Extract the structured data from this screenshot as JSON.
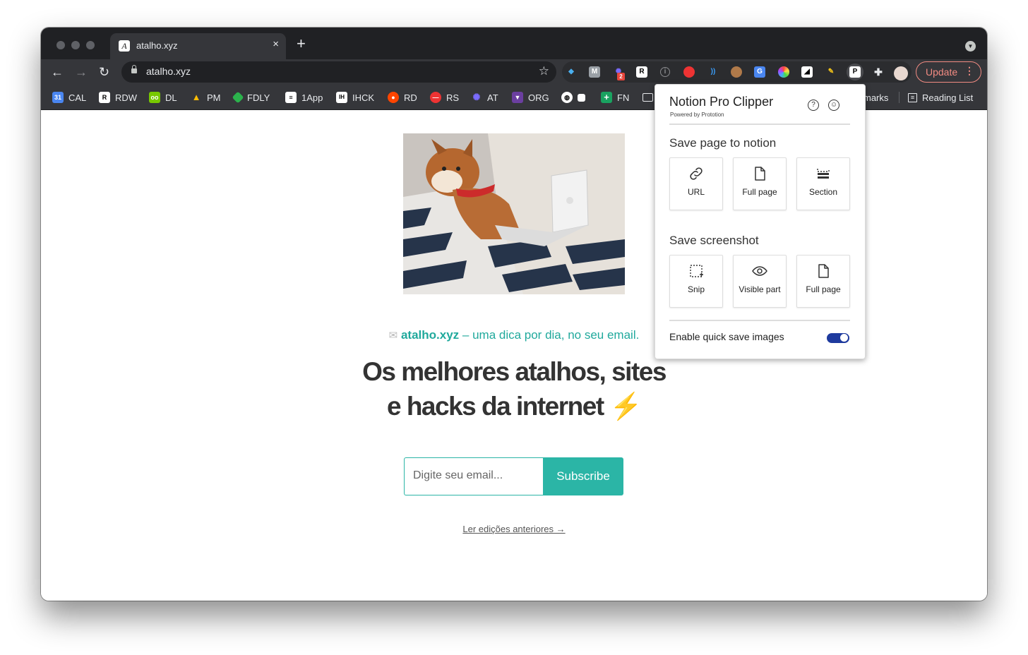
{
  "browser": {
    "tab_title": "atalho.xyz",
    "tab_close": "×",
    "new_tab": "+",
    "url": "atalho.xyz",
    "update_label": "Update",
    "bookmarks": [
      "CAL",
      "RDW",
      "DL",
      "PM",
      "FDLY",
      "1App",
      "IHCK",
      "RD",
      "RS",
      "AT",
      "ORG",
      "FN"
    ],
    "bookmarks_more": "marks",
    "reading_list": "Reading List",
    "extension_badge": "2"
  },
  "page": {
    "tagline_site": "atalho.xyz",
    "tagline_rest": " – uma dica por dia, no seu email.",
    "headline_line1": "Os melhores atalhos, sites",
    "headline_line2": "e hacks da internet",
    "headline_emoji": "⚡",
    "email_placeholder": "Digite seu email...",
    "subscribe_label": "Subscribe",
    "previous_link": "Ler edições anteriores →"
  },
  "popup": {
    "title": "Notion Pro Clipper",
    "subtitle": "Powered by Prototion",
    "section1": "Save page to notion",
    "section1_buttons": [
      "URL",
      "Full page",
      "Section"
    ],
    "section2": "Save screenshot",
    "section2_buttons": [
      "Snip",
      "Visible part",
      "Full page"
    ],
    "quick_save_label": "Enable quick save images",
    "quick_save_enabled": true
  },
  "colors": {
    "accent": "#2bb5a6",
    "toggle": "#1e3a9e",
    "update": "#f28b82"
  }
}
